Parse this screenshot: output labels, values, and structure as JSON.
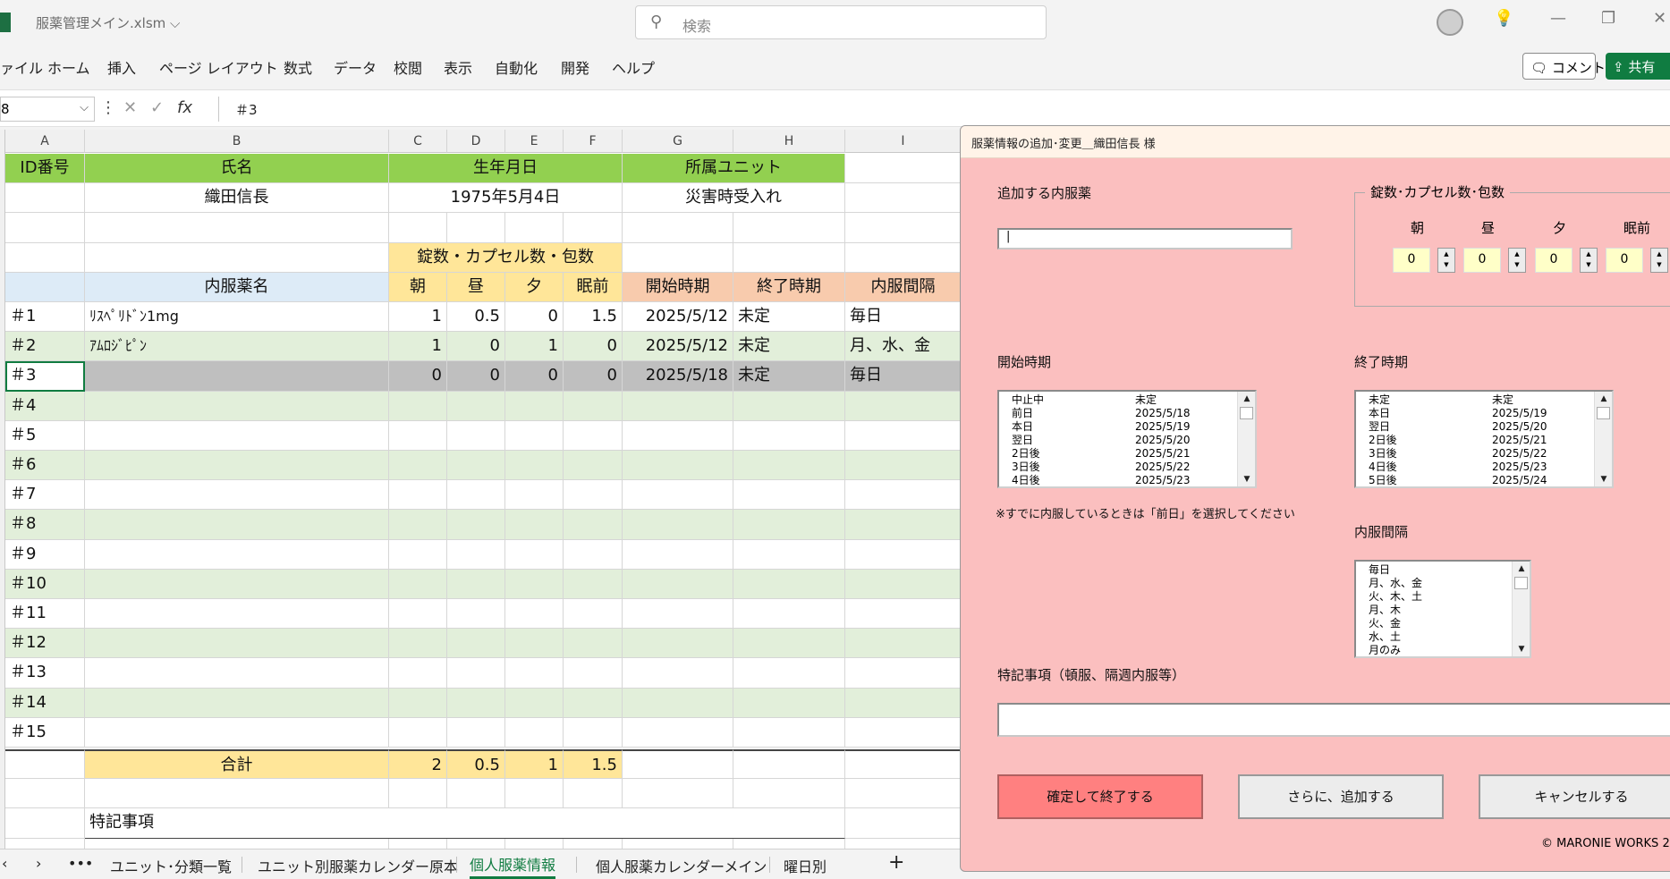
{
  "titlebar": {
    "filename": "服薬管理メイン.xlsm ⌵",
    "search_placeholder": "検索"
  },
  "menu": [
    "ァイル",
    "ホーム",
    "挿入",
    "ページ レイアウト",
    "数式",
    "データ",
    "校閲",
    "表示",
    "自動化",
    "開発",
    "ヘルプ"
  ],
  "ribbon_buttons": {
    "comment": "コメント",
    "share": "共有"
  },
  "formula_bar": {
    "namebox": "8",
    "formula": "＃3"
  },
  "columns": [
    "A",
    "B",
    "C",
    "D",
    "E",
    "F",
    "G",
    "H",
    "I"
  ],
  "patient_header": {
    "id": "ID番号",
    "name": "氏名",
    "birth": "生年月日",
    "unit": "所属ユニット"
  },
  "patient": {
    "name": "織田信長",
    "birth": "1975年5月4日",
    "unit": "災害時受入れ"
  },
  "count_header": "錠数・カプセル数・包数",
  "med_header": {
    "name": "内服薬名",
    "morning": "朝",
    "noon": "昼",
    "evening": "夕",
    "bedtime": "眠前",
    "start": "開始時期",
    "end": "終了時期",
    "interval": "内服間隔"
  },
  "rows": [
    {
      "id": "＃1",
      "name": "ﾘｽﾍﾟﾘﾄﾞﾝ1mg",
      "m": "1",
      "n": "0.5",
      "e": "0",
      "b": "1.5",
      "start": "2025/5/12",
      "end": "未定",
      "interval": "毎日"
    },
    {
      "id": "＃2",
      "name": "ｱﾑﾛｼﾞﾋﾟﾝ",
      "m": "1",
      "n": "0",
      "e": "1",
      "b": "0",
      "start": "2025/5/12",
      "end": "未定",
      "interval": "月、水、金"
    },
    {
      "id": "＃3",
      "name": "",
      "m": "0",
      "n": "0",
      "e": "0",
      "b": "0",
      "start": "2025/5/18",
      "end": "未定",
      "interval": "毎日"
    },
    {
      "id": "＃4",
      "name": "",
      "m": "",
      "n": "",
      "e": "",
      "b": "",
      "start": "",
      "end": "",
      "interval": ""
    },
    {
      "id": "＃5",
      "name": "",
      "m": "",
      "n": "",
      "e": "",
      "b": "",
      "start": "",
      "end": "",
      "interval": ""
    },
    {
      "id": "＃6",
      "name": "",
      "m": "",
      "n": "",
      "e": "",
      "b": "",
      "start": "",
      "end": "",
      "interval": ""
    },
    {
      "id": "＃7",
      "name": "",
      "m": "",
      "n": "",
      "e": "",
      "b": "",
      "start": "",
      "end": "",
      "interval": ""
    },
    {
      "id": "＃8",
      "name": "",
      "m": "",
      "n": "",
      "e": "",
      "b": "",
      "start": "",
      "end": "",
      "interval": ""
    },
    {
      "id": "＃9",
      "name": "",
      "m": "",
      "n": "",
      "e": "",
      "b": "",
      "start": "",
      "end": "",
      "interval": ""
    },
    {
      "id": "＃10",
      "name": "",
      "m": "",
      "n": "",
      "e": "",
      "b": "",
      "start": "",
      "end": "",
      "interval": ""
    },
    {
      "id": "＃11",
      "name": "",
      "m": "",
      "n": "",
      "e": "",
      "b": "",
      "start": "",
      "end": "",
      "interval": ""
    },
    {
      "id": "＃12",
      "name": "",
      "m": "",
      "n": "",
      "e": "",
      "b": "",
      "start": "",
      "end": "",
      "interval": ""
    },
    {
      "id": "＃13",
      "name": "",
      "m": "",
      "n": "",
      "e": "",
      "b": "",
      "start": "",
      "end": "",
      "interval": ""
    },
    {
      "id": "＃14",
      "name": "",
      "m": "",
      "n": "",
      "e": "",
      "b": "",
      "start": "",
      "end": "",
      "interval": ""
    },
    {
      "id": "＃15",
      "name": "",
      "m": "",
      "n": "",
      "e": "",
      "b": "",
      "start": "",
      "end": "",
      "interval": ""
    }
  ],
  "total": {
    "label": "合計",
    "m": "2",
    "n": "0.5",
    "e": "1",
    "b": "1.5"
  },
  "notes_label": "特記事項",
  "sheet_tabs": [
    "ユニット･分類一覧",
    "ユニット別服薬カレンダー原本",
    "個人服薬情報",
    "個人服薬カレンダーメイン",
    "曜日別"
  ],
  "active_tab": "個人服薬情報",
  "dialog": {
    "title": "服薬情報の追加･変更＿織田信長 様",
    "add_med_label": "追加する内服薬",
    "count_label": "錠数･カプセル数･包数",
    "spin_labels": [
      "朝",
      "昼",
      "夕",
      "眠前"
    ],
    "spin_values": [
      "0",
      "0",
      "0",
      "0"
    ],
    "start_label": "開始時期",
    "end_label": "終了時期",
    "start_list": [
      [
        "中止中",
        "未定"
      ],
      [
        "前日",
        "2025/5/18"
      ],
      [
        "本日",
        "2025/5/19"
      ],
      [
        "翌日",
        "2025/5/20"
      ],
      [
        "2日後",
        "2025/5/21"
      ],
      [
        "3日後",
        "2025/5/22"
      ],
      [
        "4日後",
        "2025/5/23"
      ]
    ],
    "end_list": [
      [
        "未定",
        "未定"
      ],
      [
        "本日",
        "2025/5/19"
      ],
      [
        "翌日",
        "2025/5/20"
      ],
      [
        "2日後",
        "2025/5/21"
      ],
      [
        "3日後",
        "2025/5/22"
      ],
      [
        "4日後",
        "2025/5/23"
      ],
      [
        "5日後",
        "2025/5/24"
      ]
    ],
    "start_note": "※すでに内服しているときは「前日」を選択してください",
    "interval_label": "内服間隔",
    "interval_list": [
      "毎日",
      "月、水、金",
      "火、木、土",
      "月、木",
      "火、金",
      "水、土",
      "月のみ"
    ],
    "notes_label": "特記事項（頓服、隔週内服等）",
    "btn_confirm": "確定して終了する",
    "btn_add_more": "さらに、追加する",
    "btn_cancel": "キャンセルする",
    "copyright": "© MARONIE WORKS 2"
  },
  "colors": {
    "green_header": "#92d050",
    "yellow_header": "#ffe699",
    "orange_header": "#f8cbad",
    "blue_header": "#ddebf7",
    "row_green": "#e2efda",
    "selected_gray": "#bfbfbf",
    "dialog_bg": "#fbbfbf",
    "excel_green": "#107c41"
  }
}
